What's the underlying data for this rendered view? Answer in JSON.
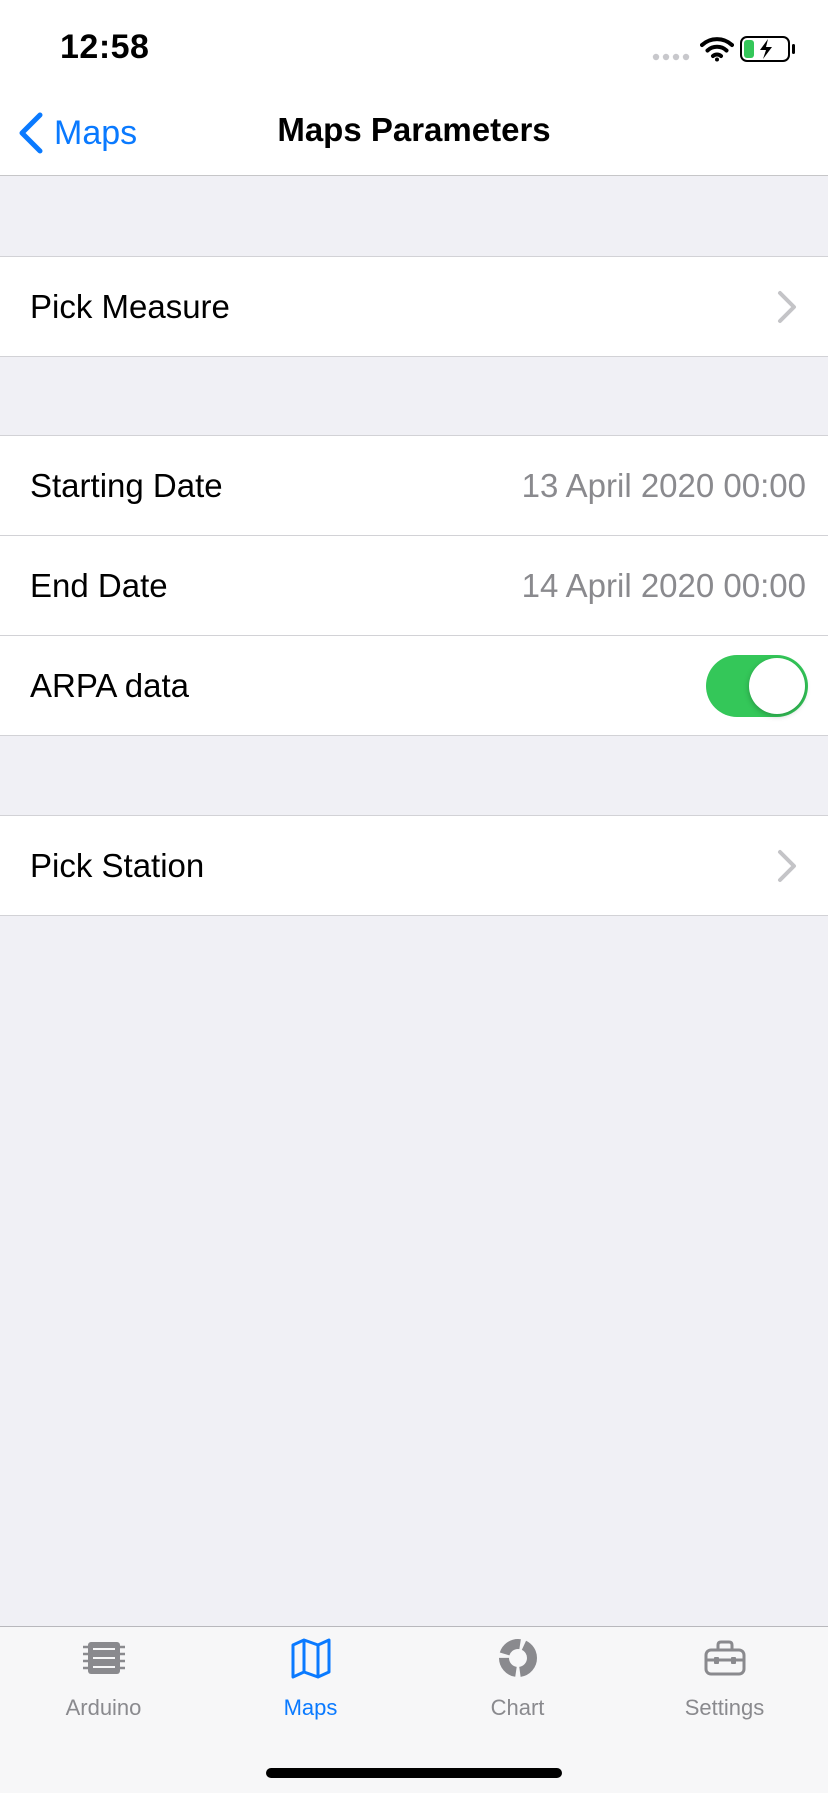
{
  "status_bar": {
    "time": "12:58",
    "icons": [
      "signal-dots-icon",
      "wifi-icon",
      "battery-charging-icon"
    ]
  },
  "nav": {
    "back_label": "Maps",
    "title": "Maps Parameters"
  },
  "rows": {
    "pick_measure": {
      "label": "Pick Measure"
    },
    "starting_date": {
      "label": "Starting Date",
      "value": "13 April 2020 00:00"
    },
    "end_date": {
      "label": "End Date",
      "value": "14 April 2020 00:00"
    },
    "arpa_data": {
      "label": "ARPA data",
      "on": true
    },
    "pick_station": {
      "label": "Pick Station"
    }
  },
  "tabs": [
    {
      "label": "Arduino",
      "icon": "chip-icon",
      "active": false
    },
    {
      "label": "Maps",
      "icon": "map-icon",
      "active": true
    },
    {
      "label": "Chart",
      "icon": "pie-chart-icon",
      "active": false
    },
    {
      "label": "Settings",
      "icon": "toolbox-icon",
      "active": false
    }
  ],
  "colors": {
    "accent": "#0a7aff",
    "toggle_on": "#34c759",
    "background": "#f0f0f5",
    "secondary_text": "#8a8a8e"
  }
}
